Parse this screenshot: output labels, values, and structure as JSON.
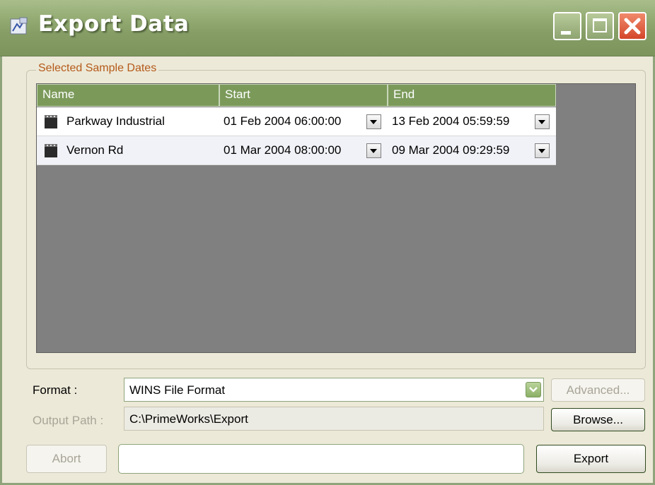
{
  "window": {
    "title": "Export Data",
    "icons": {
      "app": "export-app-icon",
      "minimize": "minimize-icon",
      "maximize": "maximize-icon",
      "close": "close-icon"
    }
  },
  "selected_dates": {
    "group_label": "Selected Sample Dates",
    "columns": [
      "Name",
      "Start",
      "End"
    ],
    "rows": [
      {
        "name": "Parkway Industrial",
        "start": "01 Feb 2004 06:00:00",
        "end": "13 Feb 2004 05:59:59"
      },
      {
        "name": "Vernon Rd",
        "start": "01 Mar 2004 08:00:00",
        "end": "09 Mar 2004 09:29:59"
      }
    ]
  },
  "format": {
    "label": "Format :",
    "value": "WINS File Format",
    "advanced_label": "Advanced..."
  },
  "output": {
    "label": "Output Path :",
    "value": "C:\\PrimeWorks\\Export",
    "browse_label": "Browse..."
  },
  "actions": {
    "abort_label": "Abort",
    "export_label": "Export",
    "progress": 0
  },
  "colors": {
    "titlebar": "#869e66",
    "header": "#7b9a5a",
    "legend": "#b55a1a",
    "grid_bg": "#808080",
    "close_button": "#d4462a"
  }
}
